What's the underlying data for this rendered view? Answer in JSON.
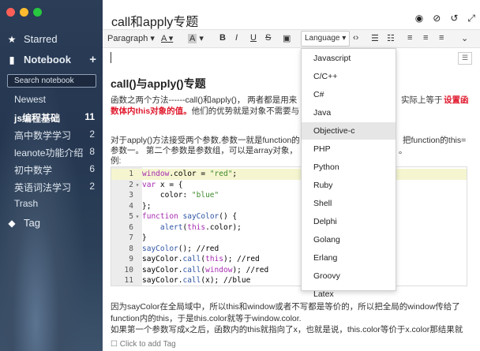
{
  "window": {
    "traffic_colors": [
      "#fd5f57",
      "#febc2e",
      "#28c840"
    ]
  },
  "sidebar": {
    "starred_label": "Starred",
    "notebook_label": "Notebook",
    "add_label": "+",
    "search_placeholder": "Search notebook",
    "items": [
      {
        "label": "Newest",
        "count": ""
      },
      {
        "label": "js编程基础",
        "count": "11"
      },
      {
        "label": "高中数学学习",
        "count": "2"
      },
      {
        "label": "leanote功能介绍",
        "count": "8"
      },
      {
        "label": "初中数学",
        "count": "6"
      },
      {
        "label": "英语词法学习",
        "count": "2"
      },
      {
        "label": "Trash",
        "count": ""
      }
    ],
    "tag_label": "Tag"
  },
  "note": {
    "title": "call和apply专题"
  },
  "toolbar": {
    "paragraph_label": "Paragraph",
    "language_label": "Language"
  },
  "language_menu": {
    "items": [
      "Javascript",
      "C/C++",
      "C#",
      "Java",
      "Objective-c",
      "PHP",
      "Python",
      "Ruby",
      "Shell",
      "Delphi",
      "Golang",
      "Erlang",
      "Groovy",
      "Latex"
    ],
    "selected": "Objective-c"
  },
  "content": {
    "heading": "call()与apply()专题",
    "p1_a": "函数之两个方法------call()和apply()， 两者都是用来",
    "p1_b": "实际上等于",
    "p1_red": "设置函",
    "p1_line2_red": "数体内this对象的值。",
    "p1_line2": "他们的优势就是对象不需要与",
    "p2_a": "对于apply()方法接受两个参数,参数一就是function的",
    "p2_b": "把function的this=",
    "p2_line2_a": "参数一。 第二个参数是参数组，可以是array对象，",
    "p2_line2_b": "。",
    "p2_line3": "例:",
    "p3_line1": "因为sayColor在全局域中，所以this和window或者不写都是等价的，所以把全局的window传给了",
    "p3_line2": "function内的this，于是this.color就等于window.color.",
    "p3_line3": "如果第一个参数写成x之后，函数内的this就指向了x，也就是说，this.color等价于x.color那结果就",
    "footer": "Click to add Tag"
  },
  "code": {
    "lines": [
      {
        "n": "1",
        "fold": "",
        "t": "window.color = \"red\";"
      },
      {
        "n": "2",
        "fold": "▾",
        "t": "var x = {"
      },
      {
        "n": "3",
        "fold": "",
        "t": "    color: \"blue\""
      },
      {
        "n": "4",
        "fold": "",
        "t": "};"
      },
      {
        "n": "5",
        "fold": "▾",
        "t": "function sayColor() {"
      },
      {
        "n": "6",
        "fold": "",
        "t": "    alert(this.color);"
      },
      {
        "n": "7",
        "fold": "",
        "t": "}"
      },
      {
        "n": "8",
        "fold": "",
        "t": "sayColor(); //red"
      },
      {
        "n": "9",
        "fold": "",
        "t": "sayColor.call(this); //red"
      },
      {
        "n": "10",
        "fold": "",
        "t": "sayColor.call(window); //red"
      },
      {
        "n": "11",
        "fold": "",
        "t": "sayColor.call(x); //blue"
      }
    ]
  }
}
